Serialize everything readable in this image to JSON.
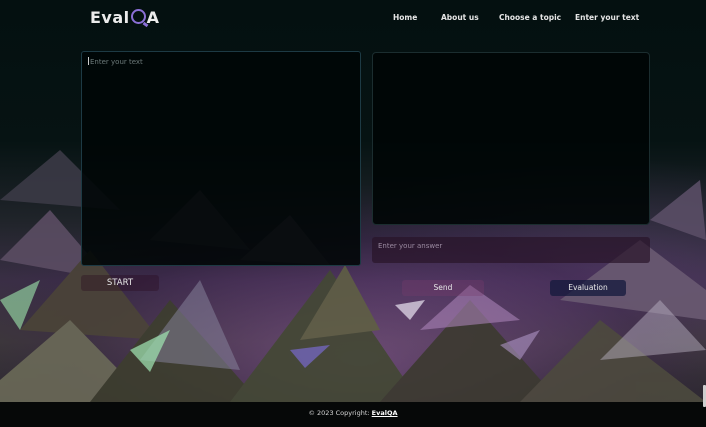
{
  "brand": {
    "name_prefix": "Eval",
    "name_suffix": "A",
    "logo_icon": "speech-bubble-q-icon",
    "accent": "#8b6fd6"
  },
  "nav": {
    "items": [
      "Home",
      "About us",
      "Choose a topic",
      "Enter your text"
    ]
  },
  "editor": {
    "placeholder": "Enter your text"
  },
  "answer": {
    "placeholder": "Enter your answer"
  },
  "buttons": {
    "start": "START",
    "send": "Send",
    "evaluation": "Evaluation"
  },
  "footer": {
    "copyright_text": "© 2023 Copyright: ",
    "copyright_link": "EvalQA"
  }
}
